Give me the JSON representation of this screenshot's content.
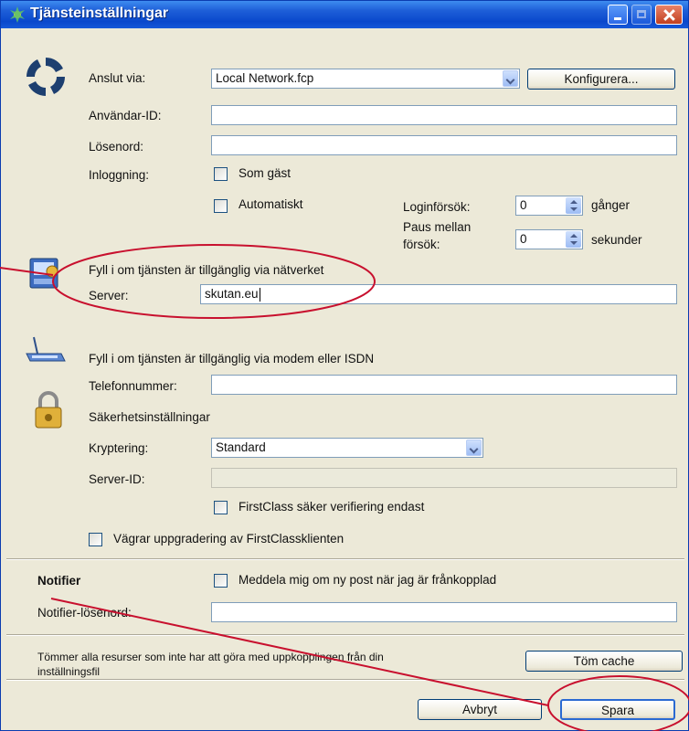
{
  "window": {
    "title": "Tjänsteinställningar"
  },
  "connection": {
    "connect_via_label": "Anslut via:",
    "connect_via_value": "Local Network.fcp",
    "configure_label": "Konfigurera...",
    "user_id_label": "Användar-ID:",
    "user_id_value": "",
    "password_label": "Lösenord:",
    "password_value": "",
    "login_label": "Inloggning:",
    "guest_label": "Som gäst",
    "automatic_label": "Automatiskt",
    "login_attempts_label": "Loginförsök:",
    "login_attempts_value": "0",
    "login_attempts_unit": "gånger",
    "pause_label_line1": "Paus mellan",
    "pause_label_line2": "försök:",
    "pause_value": "0",
    "pause_unit": "sekunder"
  },
  "network": {
    "heading": "Fyll i om tjänsten är tillgänglig via nätverket",
    "server_label": "Server:",
    "server_value": "skutan.eu"
  },
  "modem": {
    "heading": "Fyll i om tjänsten är tillgänglig via modem eller ISDN",
    "phone_label": "Telefonnummer:",
    "phone_value": ""
  },
  "security": {
    "heading": "Säkerhetsinställningar",
    "encryption_label": "Kryptering:",
    "encryption_value": "Standard",
    "server_id_label": "Server-ID:",
    "server_id_value": "",
    "secure_verify_label": "FirstClass säker verifiering endast",
    "refuse_upgrade_label": "Vägrar uppgradering av FirstClassklienten"
  },
  "notifier": {
    "heading": "Notifier",
    "notify_label": "Meddela mig om ny post när jag är frånkopplad",
    "password_label": "Notifier-lösenord:",
    "password_value": ""
  },
  "cache": {
    "text_line1": "Tömmer alla resurser som inte har att göra med uppkopplingen från din",
    "text_line2": "inställningsfil",
    "button_label": "Töm cache"
  },
  "footer": {
    "cancel_label": "Avbryt",
    "save_label": "Spara"
  },
  "colors": {
    "annotation": "#c8102e",
    "titlebar": "#0a48cc"
  },
  "icons": [
    "network-logo-icon",
    "network-computer-icon",
    "modem-icon",
    "padlock-icon"
  ]
}
